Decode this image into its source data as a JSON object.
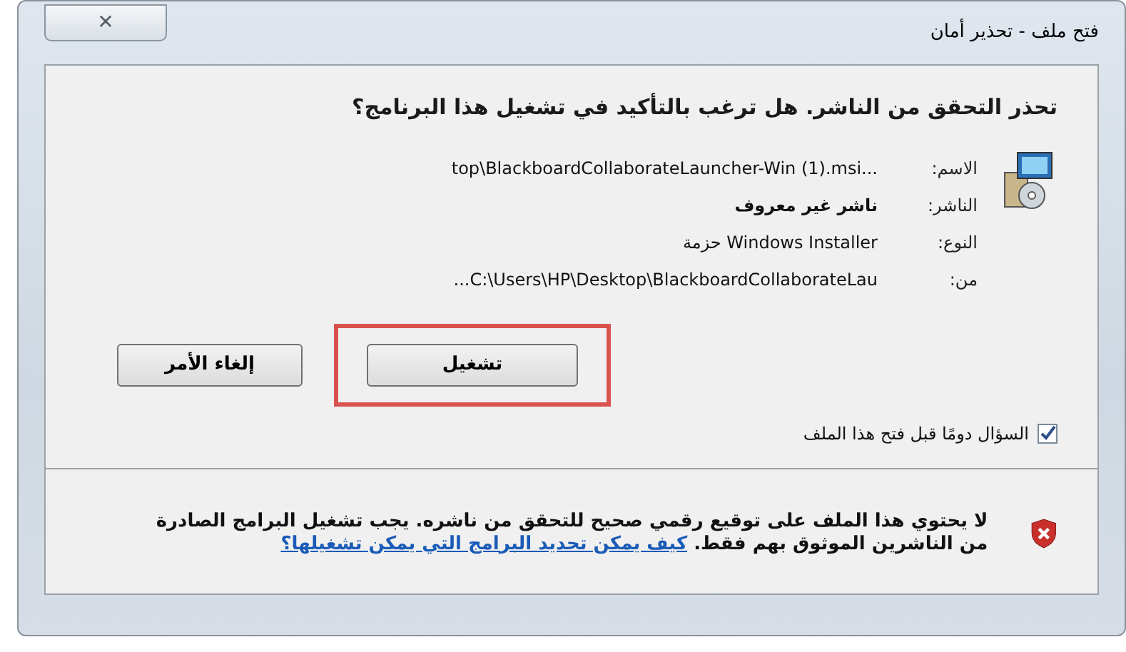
{
  "window": {
    "title": "فتح ملف - تحذير أمان",
    "close": "✕"
  },
  "heading": "تحذر التحقق من الناشر. هل ترغب بالتأكيد في تشغيل هذا البرنامج؟",
  "details": [
    {
      "label": "الاسم:",
      "value": "top\\BlackboardCollaborateLauncher-Win (1).msi...",
      "bold": false
    },
    {
      "label": "الناشر:",
      "value": "ناشر غير معروف",
      "bold": true
    },
    {
      "label": "النوع:",
      "value": "حزمة Windows Installer",
      "bold": false
    },
    {
      "label": "من:",
      "value": "...C:\\Users\\HP\\Desktop\\BlackboardCollaborateLau",
      "bold": false
    }
  ],
  "buttons": [
    {
      "label": "تشغيل",
      "highlighted": true
    },
    {
      "label": "إلغاء الأمر",
      "highlighted": false
    }
  ],
  "always_ask": {
    "label": "السؤال دومًا قبل فتح هذا الملف",
    "checked": true
  },
  "warning": {
    "text": "لا يحتوي هذا الملف على توقيع رقمي صحيح للتحقق من ناشره. يجب تشغيل البرامج الصادرة من الناشرين الموثوق بهم فقط.",
    "link": "كيف يمكن تحديد البرامج التي يمكن تشغيلها؟"
  }
}
